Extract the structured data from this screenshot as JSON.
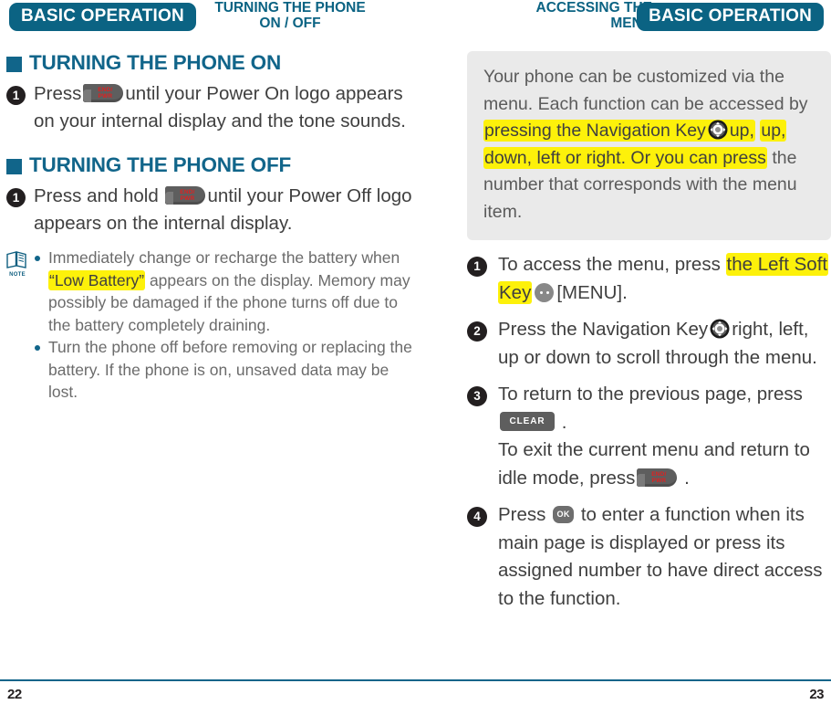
{
  "left_page": {
    "header": {
      "pill_label": "BASIC OPERATION",
      "chapter_line1": "TURNING THE PHONE",
      "chapter_line2": "ON / OFF"
    },
    "section1": {
      "heading": "TURNING THE PHONE ON",
      "step1_num": "1",
      "step1_a": "Press",
      "step1_key": "END/PWR",
      "step1_b": "until your Power On logo appears on your internal display and the tone sounds."
    },
    "section2": {
      "heading": "TURNING THE PHONE OFF",
      "step1_num": "1",
      "step1_a": "Press and hold",
      "step1_key": "END/PWR",
      "step1_b": "until your Power Off logo appears on the internal display."
    },
    "note": {
      "icon_label": "NOTE",
      "item1_a": "Immediately change or recharge the battery when",
      "item1_hl": "“Low Battery”",
      "item1_b": "appears on the display. Memory may possibly be damaged if the phone turns off due to the battery completely draining.",
      "item2": "Turn the phone off before removing or replacing the battery. If the phone is on, unsaved data may be lost."
    },
    "page_number": "22"
  },
  "right_page": {
    "header": {
      "pill_label": "BASIC OPERATION",
      "chapter_line1": "ACCESSING THE",
      "chapter_line2": "MENU"
    },
    "infobox": {
      "text_a": "Your phone can be customized via the menu. Each function can be accessed by",
      "hl_a": "pressing the Navigation Key",
      "hl_b": "up, down, left or right. Or you can press",
      "text_b": "the number that corresponds with the menu item."
    },
    "steps": [
      {
        "num": "1",
        "text_a": "To access the menu, press",
        "hl_a": "the Left Soft Key",
        "text_b": "[MENU]."
      },
      {
        "num": "2",
        "text_a": "Press the Navigation Key",
        "text_b": "right, left, up or down to scroll through the menu."
      },
      {
        "num": "3",
        "text_a": "To return to the previous page, press",
        "key_label": "CLEAR",
        "text_b": ".",
        "text_c": "To exit the current menu and return to idle mode, press",
        "text_d": "."
      },
      {
        "num": "4",
        "text_a": "Press",
        "key_label": "OK",
        "text_b": "to enter a function when its main page is displayed or press its assigned number to have direct access to the function."
      }
    ],
    "page_number": "23"
  },
  "colors": {
    "brand_teal": "#11658a",
    "pill_teal": "#0b6383",
    "highlight_yellow": "#fdf10a",
    "info_panel_grey": "#eaeaea",
    "body_text": "#3f3f3f",
    "note_text": "#6b6b6b",
    "key_red": "#e02020"
  }
}
